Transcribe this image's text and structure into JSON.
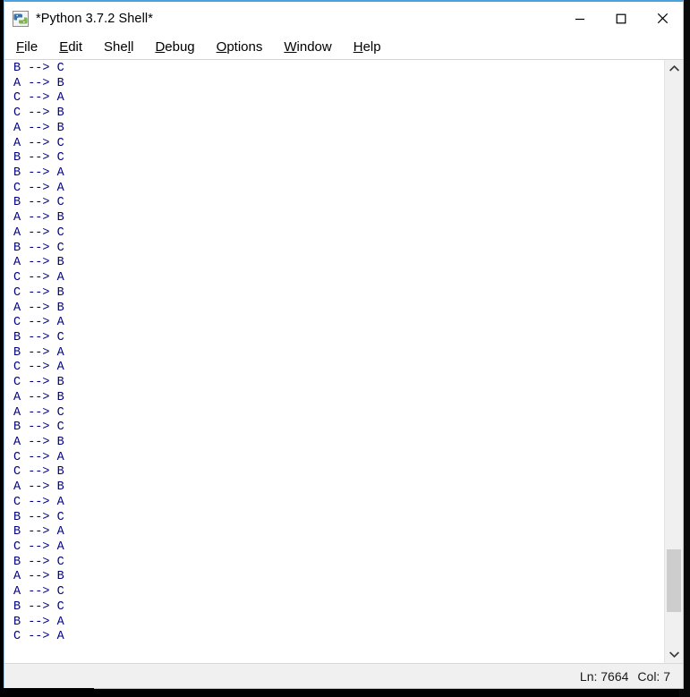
{
  "window": {
    "title": "*Python 3.7.2 Shell*",
    "icon": "python-idle-icon",
    "controls": {
      "minimize_label": "—",
      "maximize_label": "□",
      "close_label": "✕"
    }
  },
  "menubar": {
    "items": [
      {
        "name": "file",
        "pre": "",
        "mnemonic": "F",
        "post": "ile"
      },
      {
        "name": "edit",
        "pre": "",
        "mnemonic": "E",
        "post": "dit"
      },
      {
        "name": "shell",
        "pre": "She",
        "mnemonic": "l",
        "post": "l"
      },
      {
        "name": "debug",
        "pre": "",
        "mnemonic": "D",
        "post": "ebug"
      },
      {
        "name": "options",
        "pre": "",
        "mnemonic": "O",
        "post": "ptions"
      },
      {
        "name": "window",
        "pre": "",
        "mnemonic": "W",
        "post": "indow"
      },
      {
        "name": "help",
        "pre": "",
        "mnemonic": "H",
        "post": "elp"
      }
    ]
  },
  "shell": {
    "text_color": "#000080",
    "background": "#ffffff",
    "lines": [
      "B --> C",
      "A --> B",
      "C --> A",
      "C --> B",
      "A --> B",
      "A --> C",
      "B --> C",
      "B --> A",
      "C --> A",
      "B --> C",
      "A --> B",
      "A --> C",
      "B --> C",
      "A --> B",
      "C --> A",
      "C --> B",
      "A --> B",
      "C --> A",
      "B --> C",
      "B --> A",
      "C --> A",
      "C --> B",
      "A --> B",
      "A --> C",
      "B --> C",
      "A --> B",
      "C --> A",
      "C --> B",
      "A --> B",
      "C --> A",
      "B --> C",
      "B --> A",
      "C --> A",
      "B --> C",
      "A --> B",
      "A --> C",
      "B --> C",
      "B --> A",
      "C --> A"
    ]
  },
  "scrollbar": {
    "up_arrow": "⌃",
    "down_arrow": "⌄",
    "thumb_top_pct": 83,
    "thumb_height_pct": 11
  },
  "statusbar": {
    "line_label": "Ln: 7664",
    "col_label": "Col: 7"
  }
}
